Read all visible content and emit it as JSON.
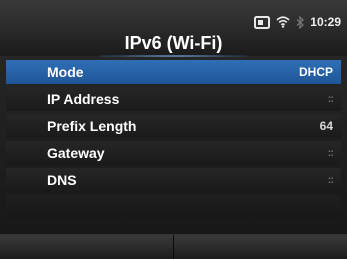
{
  "status": {
    "time": "10:29",
    "icons": [
      "card-icon",
      "wifi-icon",
      "bluetooth-icon"
    ]
  },
  "title": "IPv6 (Wi-Fi)",
  "items": [
    {
      "label": "Mode",
      "value": "DHCP",
      "selected": true
    },
    {
      "label": "IP Address",
      "value": "::",
      "selected": false
    },
    {
      "label": "Prefix Length",
      "value": "64",
      "selected": false
    },
    {
      "label": "Gateway",
      "value": "::",
      "selected": false
    },
    {
      "label": "DNS",
      "value": "::",
      "selected": false
    }
  ],
  "colors": {
    "selected": "#2566a8",
    "background": "#1a1a1a"
  }
}
